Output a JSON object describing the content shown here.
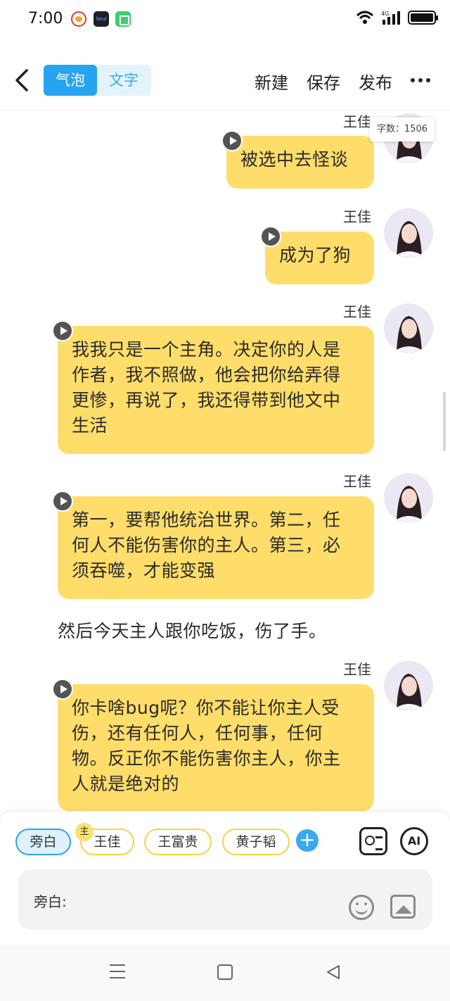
{
  "status_bar": {
    "time": "7:00",
    "apps": [
      "weibo-icon",
      "soul-icon",
      "green-app-icon"
    ],
    "network": "4G",
    "soul_label": "Soul"
  },
  "toolbar": {
    "tabs": [
      {
        "label": "气泡",
        "active": true
      },
      {
        "label": "文字",
        "active": false
      }
    ],
    "actions": {
      "new": "新建",
      "save": "保存",
      "publish": "发布"
    }
  },
  "chat": {
    "word_count": "字数：1506",
    "messages": [
      {
        "type": "bubble",
        "speaker": "王佳",
        "text": "被选中去怪谈"
      },
      {
        "type": "bubble",
        "speaker": "王佳",
        "text": "成为了狗"
      },
      {
        "type": "bubble",
        "speaker": "王佳",
        "lines": [
          "我我只是一个主角。决定你的人是",
          "作者，我不照做，他会把你给弄得",
          "更惨，再说了，我还得带到他文中",
          "生活"
        ]
      },
      {
        "type": "bubble",
        "speaker": "王佳",
        "lines": [
          "第一，要帮他统治世界。第二，任",
          "何人不能伤害你的主人。第三，必",
          "须吞噬，才能变强"
        ]
      },
      {
        "type": "narration",
        "text": "然后今天主人跟你吃饭，伤了手。"
      },
      {
        "type": "bubble",
        "speaker": "王佳",
        "lines": [
          "你卡啥bug呢？你不能让你主人受",
          "伤，还有任何人，任何事，任何",
          "物。反正你不能伤害你主人，你主",
          "人就是绝对的"
        ]
      }
    ]
  },
  "composer": {
    "roles": [
      {
        "label": "旁白",
        "active": true
      },
      {
        "label": "王佳",
        "badge": "主"
      },
      {
        "label": "王富贵"
      },
      {
        "label": "黄子韬"
      }
    ],
    "add_label": "+",
    "ai_label": "AI",
    "input_label": "旁白:"
  },
  "colors": {
    "bubble": "#fedd6a",
    "accent": "#27a4ef",
    "chip_border": "#f4d24a"
  }
}
